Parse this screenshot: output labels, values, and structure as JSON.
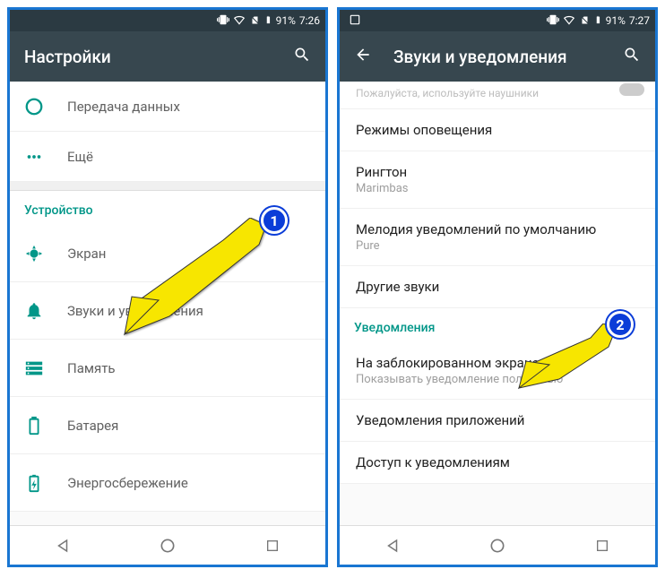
{
  "screen1": {
    "status": {
      "battery": "91%",
      "time": "7:26"
    },
    "title": "Настройки",
    "items_top": [
      {
        "icon": "data-usage",
        "label": "Передача данных"
      },
      {
        "icon": "more",
        "label": "Ещё"
      }
    ],
    "section": "Устройство",
    "items_device": [
      {
        "icon": "display",
        "label": "Экран"
      },
      {
        "icon": "bell",
        "label": "Звуки и уведомления"
      },
      {
        "icon": "storage",
        "label": "Память"
      },
      {
        "icon": "battery",
        "label": "Батарея"
      },
      {
        "icon": "energy",
        "label": "Энергосбережение"
      }
    ]
  },
  "screen2": {
    "status": {
      "battery": "91%",
      "time": "7:27"
    },
    "title": "Звуки и уведомления",
    "cut_hint": "Пожалуйста, используйте наушники",
    "rows": [
      {
        "primary": "Режимы оповещения"
      },
      {
        "primary": "Рингтон",
        "secondary": "Marimbas"
      },
      {
        "primary": "Мелодия уведомлений по умолчанию",
        "secondary": "Pure"
      },
      {
        "primary": "Другие звуки"
      }
    ],
    "section": "Уведомления",
    "rows2": [
      {
        "primary": "На заблокированном экране",
        "secondary": "Показывать уведомление полностью"
      },
      {
        "primary": "Уведомления приложений"
      },
      {
        "primary": "Доступ к уведомлениям"
      }
    ]
  },
  "callouts": {
    "one": "1",
    "two": "2"
  }
}
